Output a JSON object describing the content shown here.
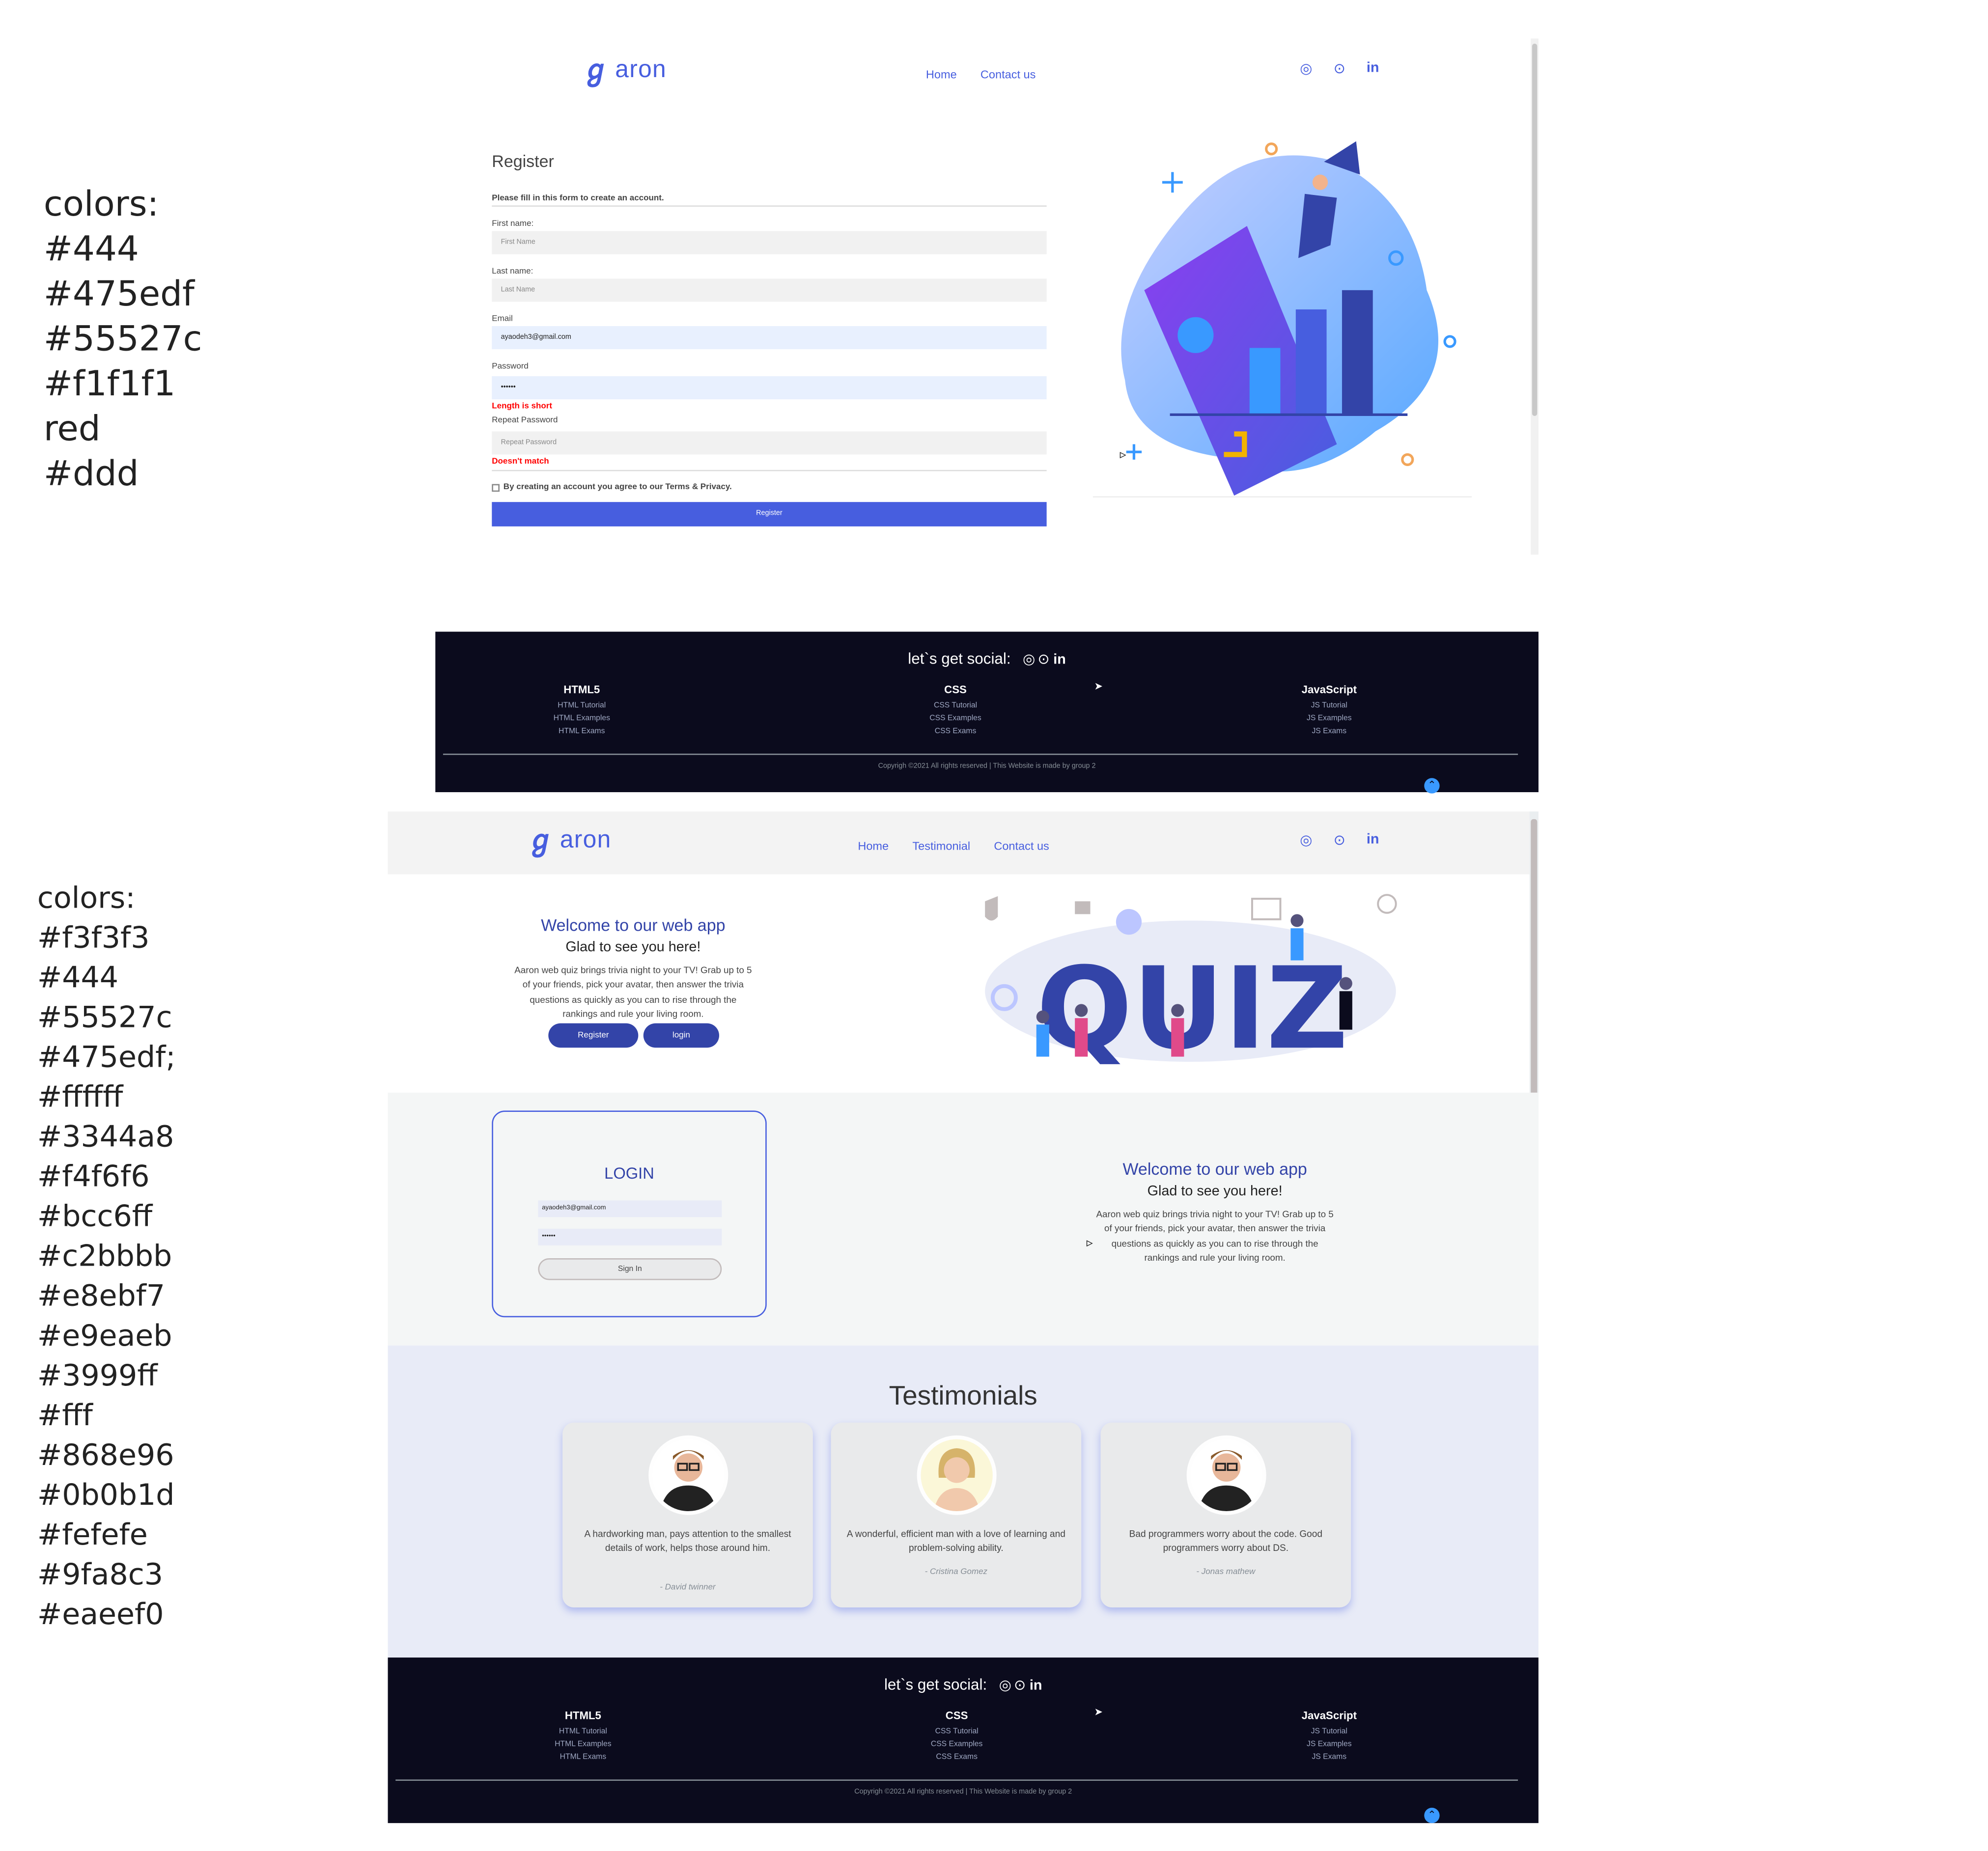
{
  "palette_top": {
    "heading": "colors:",
    "codes": [
      "#444",
      "#475edf",
      "#55527c",
      "#f1f1f1",
      "red",
      "#ddd"
    ]
  },
  "palette_bottom": {
    "heading": "colors:",
    "codes": [
      "#f3f3f3",
      "#444",
      "#55527c",
      "#475edf;",
      "#ffffff",
      "#3344a8",
      "#f4f6f6",
      "#bcc6ff",
      "#c2bbbb",
      "#e8ebf7",
      "#e9eaeb",
      "#3999ff",
      "#fff",
      "#868e96",
      "#0b0b1d",
      "#fefefe",
      "#9fa8c3",
      "#eaeef0"
    ]
  },
  "brand": {
    "name": "aron",
    "accent": "#475edf",
    "dark": "#3344a8"
  },
  "register_page": {
    "nav": [
      "Home",
      "Contact us"
    ],
    "title": "Register",
    "subtitle": "Please fill in this form to create an account.",
    "fields": {
      "first_label": "First name:",
      "first_placeholder": "First Name",
      "last_label": "Last name:",
      "last_placeholder": "Last Name",
      "email_label": "Email",
      "email_value": "ayaodeh3@gmail.com",
      "password_label": "Password",
      "password_value": "••••••",
      "password_error": "Length is short",
      "repeat_label": "Repeat Password",
      "repeat_placeholder": "Repeat Password",
      "repeat_error": "Doesn't match"
    },
    "terms": "By creating an account you agree to our Terms & Privacy.",
    "register_button": "Register"
  },
  "footer": {
    "social_label": "let`s get social:",
    "columns": [
      {
        "title": "HTML5",
        "links": [
          "HTML Tutorial",
          "HTML Examples",
          "HTML Exams"
        ]
      },
      {
        "title": "CSS",
        "links": [
          "CSS Tutorial",
          "CSS Examples",
          "CSS Exams"
        ]
      },
      {
        "title": "JavaScript",
        "links": [
          "JS Tutorial",
          "JS Examples",
          "JS Exams"
        ]
      }
    ],
    "copyright": "Copyrigh ©2021 All rights reserved | This Website is made by group 2"
  },
  "home_page": {
    "nav": [
      "Home",
      "Testimonial",
      "Contact us"
    ],
    "hero": {
      "heading": "Welcome to our web app",
      "subheading": "Glad to see you here!",
      "lines": [
        "Aaron web quiz brings trivia night to your TV! Grab up to 5",
        "of your friends, pick your avatar, then answer the trivia",
        "questions as quickly as you can to rise through the",
        "rankings and rule your living room."
      ],
      "register_button": "Register",
      "login_button": "login",
      "illustration_word": "QUIZ"
    },
    "login": {
      "title": "LOGIN",
      "email_value": "ayaodeh3@gmail.com",
      "password_value": "••••••",
      "signin_button": "Sign In"
    },
    "testimonials": {
      "title": "Testimonials",
      "items": [
        {
          "quote": "A hardworking man, pays attention to the smallest details of work, helps those around him.",
          "author": "- David twinner"
        },
        {
          "quote": "A wonderful, efficient man with a love of learning and problem-solving ability.",
          "author": "- Cristina Gomez"
        },
        {
          "quote": "Bad programmers worry about the code. Good programmers worry about DS.",
          "author": "- Jonas mathew"
        }
      ]
    }
  }
}
